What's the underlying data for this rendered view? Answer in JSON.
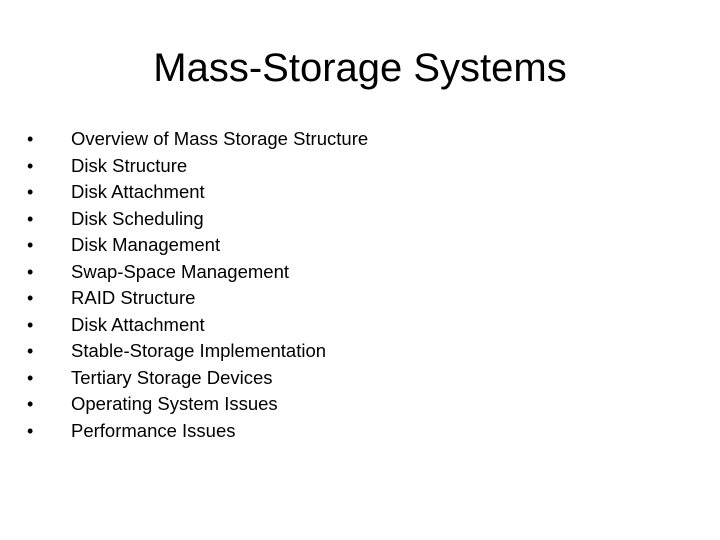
{
  "slide": {
    "title": "Mass-Storage Systems",
    "bullet_glyph": "•",
    "bullets": [
      "Overview of Mass Storage Structure",
      "Disk Structure",
      "Disk Attachment",
      "Disk Scheduling",
      "Disk Management",
      "Swap-Space Management",
      "RAID Structure",
      "Disk Attachment",
      "Stable-Storage Implementation",
      "Tertiary Storage Devices",
      "Operating System Issues",
      "Performance Issues"
    ]
  }
}
